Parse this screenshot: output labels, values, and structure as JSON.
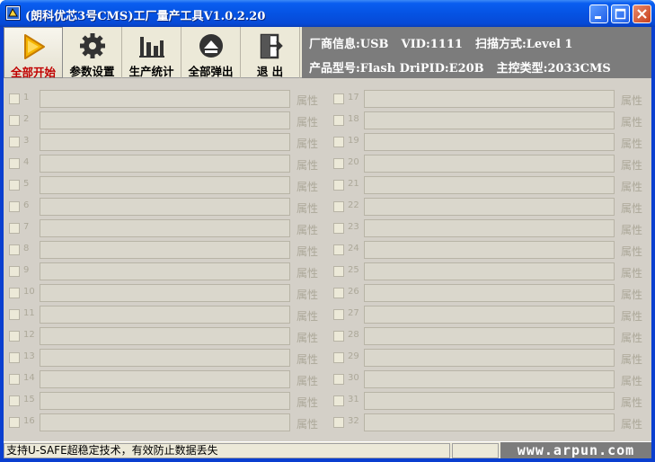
{
  "window": {
    "title": "(朗科优芯3号CMS)工厂量产工具V1.0.2.20"
  },
  "toolbar": {
    "buttons": [
      {
        "id": "start-all",
        "label": "全部开始",
        "icon": "play-icon",
        "active": true
      },
      {
        "id": "settings",
        "label": "参数设置",
        "icon": "gear-icon",
        "active": false
      },
      {
        "id": "stats",
        "label": "生产统计",
        "icon": "bar-chart-icon",
        "active": false
      },
      {
        "id": "eject-all",
        "label": "全部弹出",
        "icon": "eject-icon",
        "active": false
      },
      {
        "id": "exit",
        "label": "退 出",
        "icon": "exit-icon",
        "active": false
      }
    ]
  },
  "info": {
    "vendor": "厂商信息:USB",
    "vid": "VID:1111",
    "scan_mode": "扫描方式:Level 1",
    "product": "产品型号:Flash DriPID:E20B",
    "controller": "主控类型:2033CMS"
  },
  "ports": {
    "prop_label": "属性",
    "left": [
      "1",
      "2",
      "3",
      "4",
      "5",
      "6",
      "7",
      "8",
      "9",
      "10",
      "11",
      "12",
      "13",
      "14",
      "15",
      "16"
    ],
    "right": [
      "17",
      "18",
      "19",
      "20",
      "21",
      "22",
      "23",
      "24",
      "25",
      "26",
      "27",
      "28",
      "29",
      "30",
      "31",
      "32"
    ]
  },
  "status": {
    "message": "支持U-SAFE超稳定技术，有效防止数据丢失",
    "brand": "www.arpun.com"
  },
  "colors": {
    "title_bar": "#0553e3",
    "active_label": "#c00000",
    "info_bg": "#7c7c7c"
  }
}
